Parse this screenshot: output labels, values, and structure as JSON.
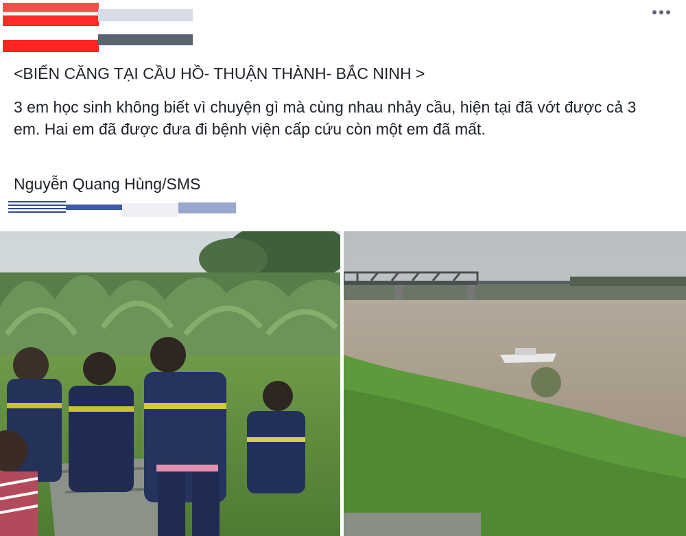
{
  "post": {
    "title": "<BIẾN CĂNG TẠI CẦU HỒ- THUẬN THÀNH- BẮC NINH >",
    "body": "3 em học sinh không biết vì chuyện gì mà cùng nhau nhảy cầu, hiện tại đã vớt được cả 3 em. Hai em đã được đưa đi bệnh viện cấp cứu còn một em đã mất.",
    "credit": "Nguyễn Quang Hùng/SMS",
    "more_icon": "more-horizontal-icon",
    "photos": [
      {
        "subject": "rescue-workers-photo"
      },
      {
        "subject": "river-bridge-photo"
      }
    ]
  },
  "colors": {
    "text": "#1d2129",
    "redact_red": "#ff2a2a",
    "redact_blue": "#3b5ba8"
  }
}
